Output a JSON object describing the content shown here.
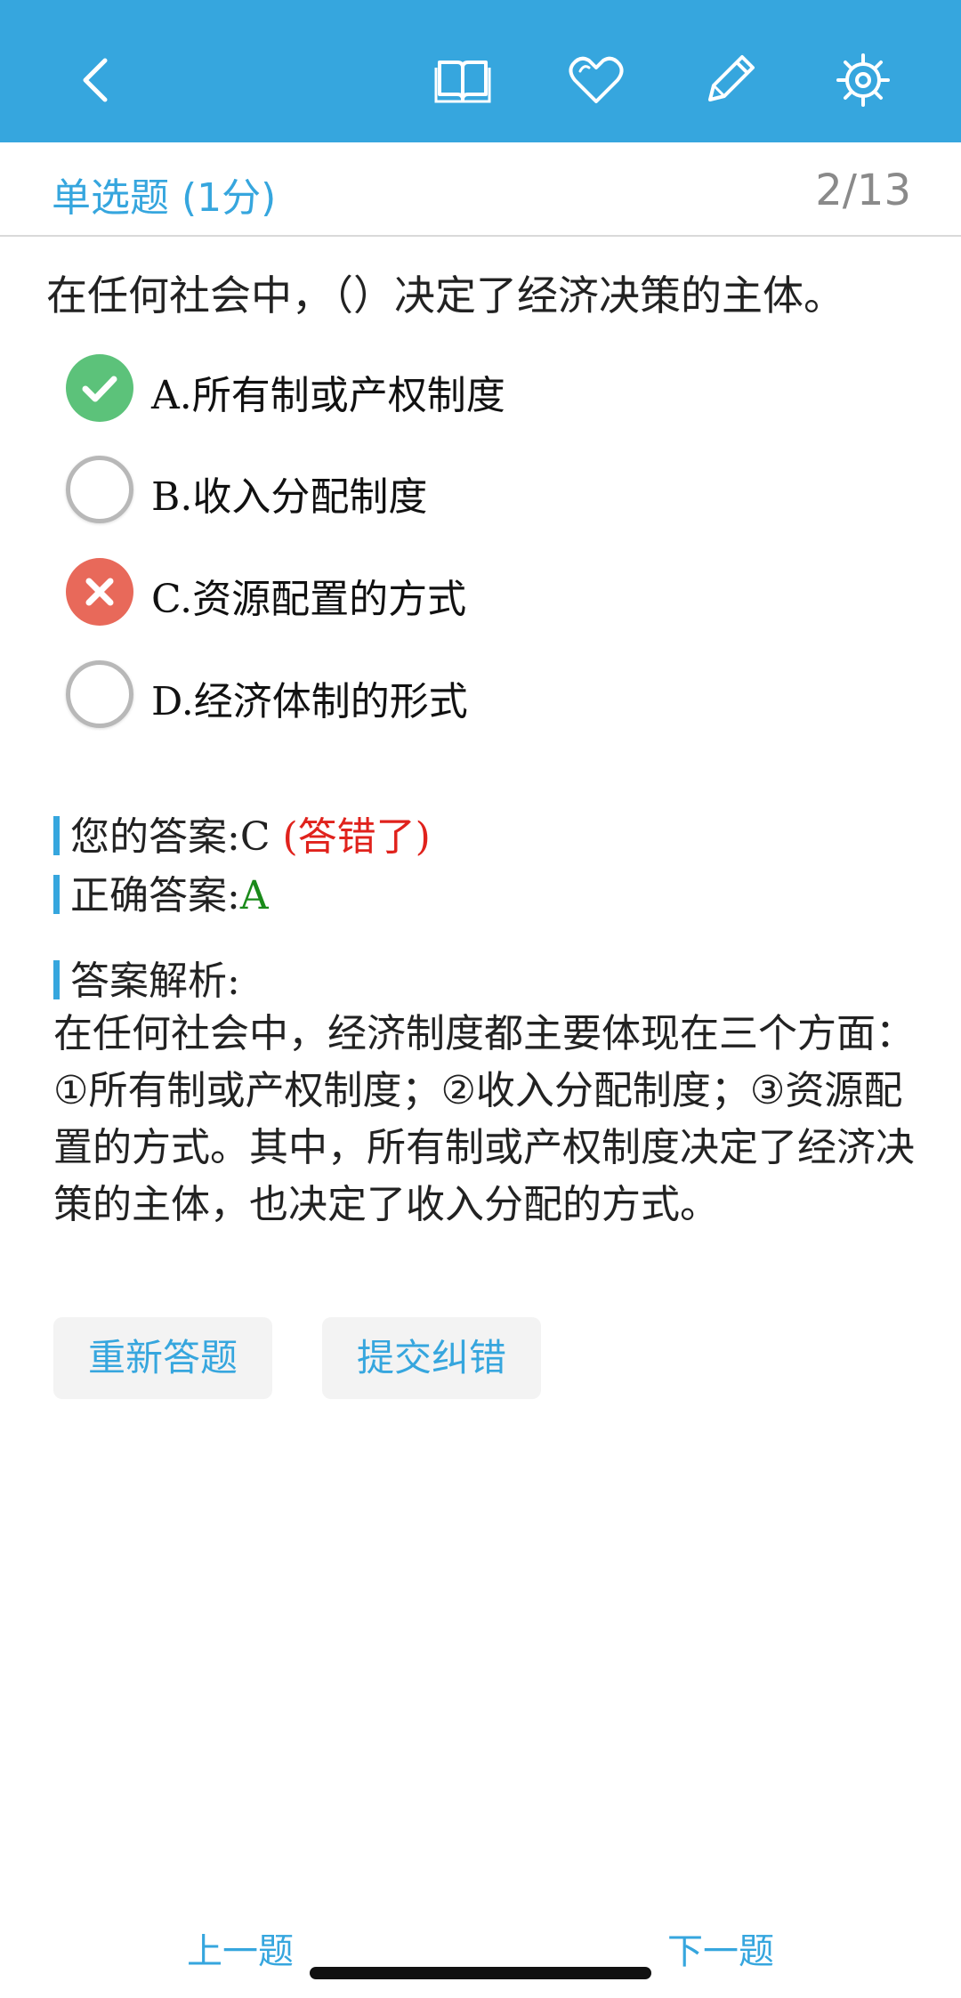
{
  "header": {
    "icons": [
      "back-arrow-icon",
      "book-icon",
      "heart-icon",
      "pencil-icon",
      "settings-gear-icon"
    ],
    "accent_color": "#36a6de"
  },
  "question": {
    "type_label": "单选题 (1分)",
    "progress": "2/13",
    "text": "在任何社会中，（）决定了经济决策的主体。",
    "options": [
      {
        "label": "A.所有制或产权制度",
        "state": "correct"
      },
      {
        "label": "B.收入分配制度",
        "state": "unselected"
      },
      {
        "label": "C.资源配置的方式",
        "state": "wrong"
      },
      {
        "label": "D.经济体制的形式",
        "state": "unselected"
      }
    ]
  },
  "result": {
    "your_answer_label": "您的答案:",
    "your_answer_value": "C",
    "wrong_tag": "(答错了)",
    "correct_answer_label": "正确答案:",
    "correct_answer_value": "A"
  },
  "analysis": {
    "title": "答案解析:",
    "text": "在任何社会中，经济制度都主要体现在三个方面：①所有制或产权制度；②收入分配制度；③资源配置的方式。其中，所有制或产权制度决定了经济决策的主体，也决定了收入分配的方式。"
  },
  "actions": {
    "redo_label": "重新答题",
    "report_label": "提交纠错"
  },
  "footer": {
    "prev_label": "上一题",
    "next_label": "下一题"
  }
}
